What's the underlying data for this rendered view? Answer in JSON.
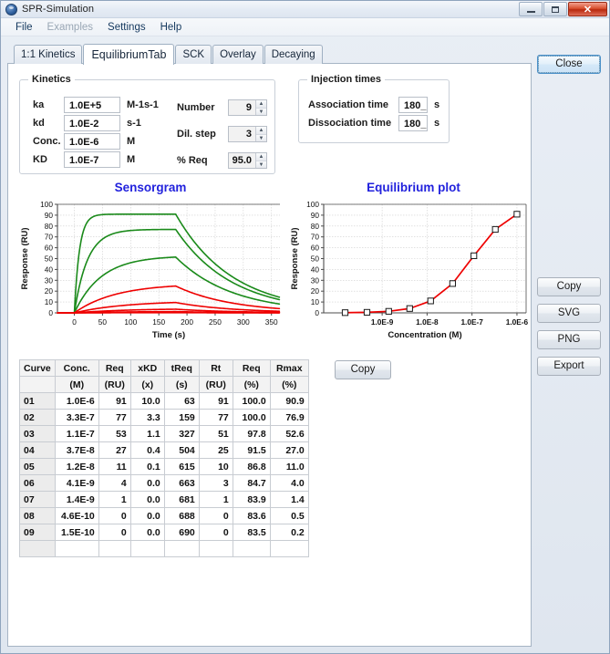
{
  "window": {
    "title": "SPR-Simulation",
    "app_icon": "spr-app-icon",
    "controls": {
      "minimize": "minimize-icon",
      "maximize": "maximize-icon",
      "close": "✕"
    }
  },
  "menubar": {
    "items": [
      {
        "label": "File",
        "disabled": false
      },
      {
        "label": "Examples",
        "disabled": true
      },
      {
        "label": "Settings",
        "disabled": false
      },
      {
        "label": "Help",
        "disabled": false
      }
    ]
  },
  "tabs": [
    {
      "label": "1:1 Kinetics",
      "active": false
    },
    {
      "label": "EquilibriumTab",
      "active": true
    },
    {
      "label": "SCK",
      "active": false
    },
    {
      "label": "Overlay",
      "active": false
    },
    {
      "label": "Decaying",
      "active": false
    }
  ],
  "kinetics": {
    "title": "Kinetics",
    "rows": [
      {
        "label": "ka",
        "value": "1.0E+5",
        "unit": "M-1s-1"
      },
      {
        "label": "kd",
        "value": "1.0E-2",
        "unit": "s-1"
      },
      {
        "label": "Conc.",
        "value": "1.0E-6",
        "unit": "M"
      },
      {
        "label": "KD",
        "value": "1.0E-7",
        "unit": "M"
      }
    ],
    "spinners": [
      {
        "label": "Number",
        "value": "9"
      },
      {
        "label": "Dil. step",
        "value": "3"
      },
      {
        "label": "% Req",
        "value": "95.0"
      }
    ]
  },
  "injection": {
    "title": "Injection times",
    "rows": [
      {
        "label": "Association time",
        "value": "180_",
        "unit": "s"
      },
      {
        "label": "Dissociation time",
        "value": "180_",
        "unit": "s"
      }
    ]
  },
  "table": {
    "copy_label": "Copy",
    "headers_line1": [
      "Curve",
      "Conc.",
      "Req",
      "xKD",
      "tReq",
      "Rt",
      "Req",
      "Rmax"
    ],
    "headers_line2": [
      "",
      "(M)",
      "(RU)",
      "(x)",
      "(s)",
      "(RU)",
      "(%)",
      "(%)"
    ],
    "rows": [
      [
        "01",
        "1.0E-6",
        "91",
        "10.0",
        "63",
        "91",
        "100.0",
        "90.9"
      ],
      [
        "02",
        "3.3E-7",
        "77",
        "3.3",
        "159",
        "77",
        "100.0",
        "76.9"
      ],
      [
        "03",
        "1.1E-7",
        "53",
        "1.1",
        "327",
        "51",
        "97.8",
        "52.6"
      ],
      [
        "04",
        "3.7E-8",
        "27",
        "0.4",
        "504",
        "25",
        "91.5",
        "27.0"
      ],
      [
        "05",
        "1.2E-8",
        "11",
        "0.1",
        "615",
        "10",
        "86.8",
        "11.0"
      ],
      [
        "06",
        "4.1E-9",
        "4",
        "0.0",
        "663",
        "3",
        "84.7",
        "4.0"
      ],
      [
        "07",
        "1.4E-9",
        "1",
        "0.0",
        "681",
        "1",
        "83.9",
        "1.4"
      ],
      [
        "08",
        "4.6E-10",
        "0",
        "0.0",
        "688",
        "0",
        "83.6",
        "0.5"
      ],
      [
        "09",
        "1.5E-10",
        "0",
        "0.0",
        "690",
        "0",
        "83.5",
        "0.2"
      ]
    ]
  },
  "buttons": {
    "close": "Close",
    "copy": "Copy",
    "svg": "SVG",
    "png": "PNG",
    "export": "Export"
  },
  "colors": {
    "title_blue": "#2222dd",
    "curve_green": "#1a8a1a",
    "curve_red": "#ee0000",
    "grid": "#cccccc",
    "axis": "#555555"
  },
  "chart_data": [
    {
      "type": "line",
      "name": "sensorgram",
      "title": "Sensorgram",
      "xlabel": "Time (s)",
      "ylabel": "Response (RU)",
      "xlim": [
        -30,
        365
      ],
      "ylim": [
        0,
        100
      ],
      "xticks": [
        0,
        50,
        100,
        150,
        200,
        250,
        300,
        350
      ],
      "yticks": [
        0,
        10,
        20,
        30,
        40,
        50,
        60,
        70,
        80,
        90,
        100
      ],
      "grid": true,
      "legend": "none",
      "association_time": 180,
      "dissociation_time": 180,
      "series": [
        {
          "name": "01",
          "color": "#1a8a1a",
          "req": 90.9,
          "rt": 91,
          "ka": 100000,
          "kd": 0.01,
          "conc": 1e-06
        },
        {
          "name": "02",
          "color": "#1a8a1a",
          "req": 76.9,
          "rt": 77,
          "ka": 100000,
          "kd": 0.01,
          "conc": 3.3e-07
        },
        {
          "name": "03",
          "color": "#1a8a1a",
          "req": 52.6,
          "rt": 51,
          "ka": 100000,
          "kd": 0.01,
          "conc": 1.1e-07
        },
        {
          "name": "04",
          "color": "#ee0000",
          "req": 27.0,
          "rt": 25,
          "ka": 100000,
          "kd": 0.01,
          "conc": 3.7e-08
        },
        {
          "name": "05",
          "color": "#ee0000",
          "req": 11.0,
          "rt": 10,
          "ka": 100000,
          "kd": 0.01,
          "conc": 1.2e-08
        },
        {
          "name": "06",
          "color": "#ee0000",
          "req": 4.0,
          "rt": 3,
          "ka": 100000,
          "kd": 0.01,
          "conc": 4.1e-09
        },
        {
          "name": "07",
          "color": "#ee0000",
          "req": 1.4,
          "rt": 1,
          "ka": 100000,
          "kd": 0.01,
          "conc": 1.4e-09
        },
        {
          "name": "08",
          "color": "#ee0000",
          "req": 0.5,
          "rt": 0,
          "ka": 100000,
          "kd": 0.01,
          "conc": 4.6e-10
        },
        {
          "name": "09",
          "color": "#ee0000",
          "req": 0.2,
          "rt": 0,
          "ka": 100000,
          "kd": 0.01,
          "conc": 1.5e-10
        }
      ]
    },
    {
      "type": "line",
      "name": "equilibrium-plot",
      "title": "Equilibrium plot",
      "xlabel": "Concentration (M)",
      "ylabel": "Response (RU)",
      "xscale": "log",
      "xlim": [
        5e-11,
        1.6e-06
      ],
      "ylim": [
        0,
        100
      ],
      "xticks": [
        1e-09,
        1e-08,
        1e-07,
        1e-06
      ],
      "xtick_labels": [
        "1.0E-9",
        "1.0E-8",
        "1.0E-7",
        "1.0E-6"
      ],
      "yticks": [
        0,
        10,
        20,
        30,
        40,
        50,
        60,
        70,
        80,
        90,
        100
      ],
      "grid": true,
      "marker": "open-square",
      "line_color": "#ee0000",
      "points": [
        {
          "x": 1.5e-10,
          "y": 0.2
        },
        {
          "x": 4.6e-10,
          "y": 0.5
        },
        {
          "x": 1.4e-09,
          "y": 1.4
        },
        {
          "x": 4.1e-09,
          "y": 4.0
        },
        {
          "x": 1.2e-08,
          "y": 11.0
        },
        {
          "x": 3.7e-08,
          "y": 27.0
        },
        {
          "x": 1.1e-07,
          "y": 52.6
        },
        {
          "x": 3.3e-07,
          "y": 76.9
        },
        {
          "x": 1e-06,
          "y": 90.9
        }
      ]
    }
  ]
}
